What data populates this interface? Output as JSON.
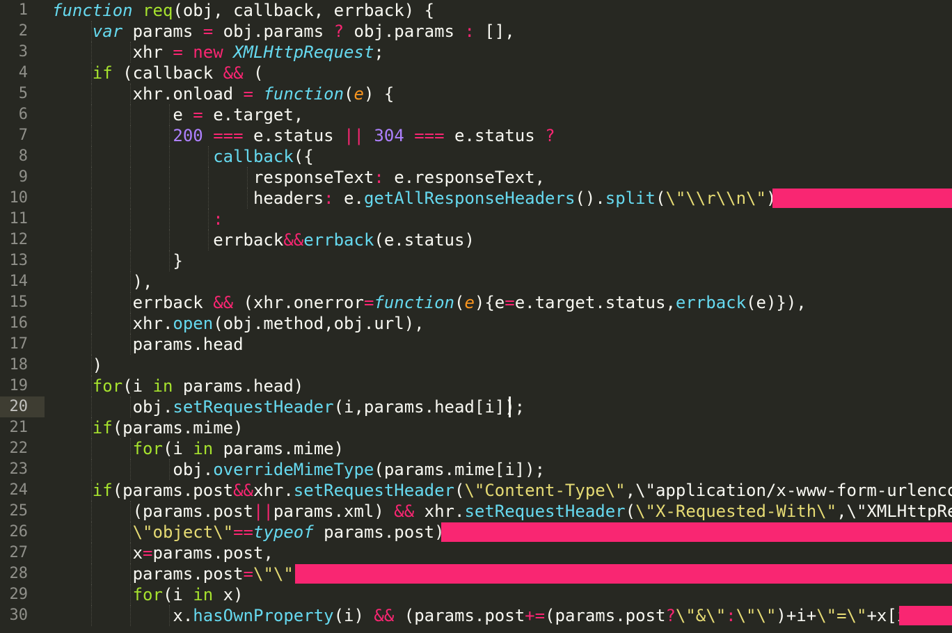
{
  "editor": {
    "active_line": 20,
    "line_numbers": [
      "1",
      "2",
      "3",
      "4",
      "5",
      "6",
      "7",
      "8",
      "9",
      "10",
      "11",
      "12",
      "13",
      "14",
      "15",
      "16",
      "17",
      "18",
      "19",
      "20",
      "21",
      "22",
      "23",
      "24",
      "25",
      "26",
      "27",
      "28",
      "29",
      "30"
    ],
    "lines": [
      "function req(obj, callback, errback) {",
      "    var params = obj.params ? obj.params : [],",
      "        xhr = new XMLHttpRequest;",
      "    if (callback && (",
      "        xhr.onload = function(e) {",
      "            e = e.target,",
      "            200 === e.status || 304 === e.status ?",
      "                callback({",
      "                    responseText: e.responseText,",
      "                    headers: e.getAllResponseHeaders().split(\\\"\\\\r\\\\n\\\")})",
      "                :",
      "                errback&&errback(e.status)",
      "            }",
      "        ),",
      "        errback && (xhr.onerror=function(e){e=e.target.status,errback(e)}),",
      "        xhr.open(obj.method,obj.url),",
      "        params.head",
      "    )",
      "    for(i in params.head)",
      "        obj.setRequestHeader(i,params.head[i]);",
      "    if(params.mime)",
      "        for(i in params.mime)",
      "            obj.overrideMimeType(params.mime[i]);",
      "    if(params.post&&xhr.setRequestHeader(\\\"Content-Type\\\",\\\"application/x-www-form-urlencoded",
      "        (params.post||params.xml) && xhr.setRequestHeader(\\\"X-Requested-With\\\",\\\"XMLHttpReque",
      "        \\\"object\\\"==typeof params.post){",
      "        x=params.post,",
      "        params.post=\\\"\\\";",
      "        for(i in x)",
      "            x.hasOwnProperty(i) && (params.post+=(params.post?\\\"&\\\":\\\"\\\")+i+\\\"=\\\"+x[i])"
    ]
  },
  "colors": {
    "background": "#272822",
    "keyword": "#66d9ef",
    "operator": "#f92672",
    "number": "#ae81ff",
    "param": "#fd971f",
    "string": "#e6db74",
    "redaction": "#f92672"
  }
}
